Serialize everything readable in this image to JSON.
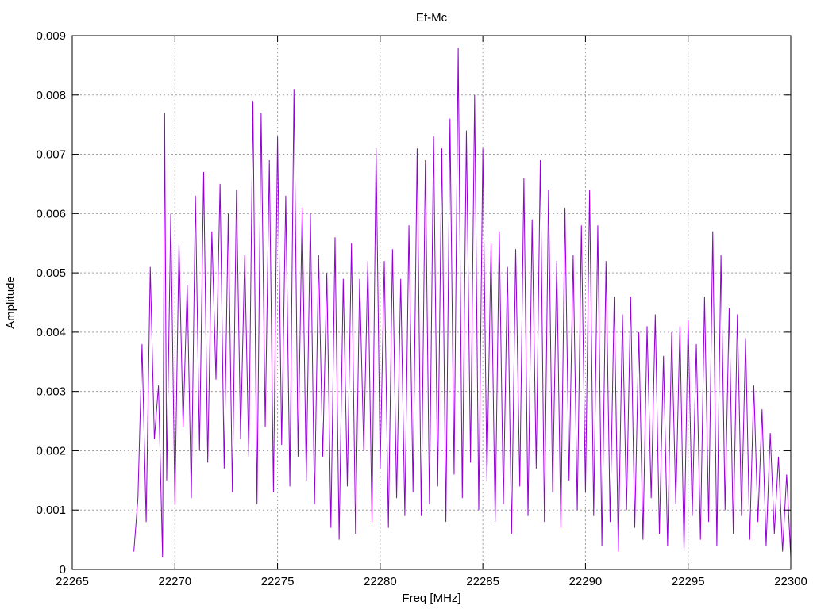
{
  "chart_data": {
    "type": "line",
    "title": "Ef-Mc",
    "xlabel": "Freq [MHz]",
    "ylabel": "Amplitude",
    "xlim": [
      22265,
      22300
    ],
    "ylim": [
      0,
      0.009
    ],
    "xticks": [
      22265,
      22270,
      22275,
      22280,
      22285,
      22290,
      22295,
      22300
    ],
    "yticks": [
      0,
      0.001,
      0.002,
      0.003,
      0.004,
      0.005,
      0.006,
      0.007,
      0.008,
      0.009
    ],
    "xtick_labels": [
      "22265",
      "22270",
      "22275",
      "22280",
      "22285",
      "22290",
      "22295",
      "22300"
    ],
    "ytick_labels": [
      "0",
      "0.001",
      "0.002",
      "0.003",
      "0.004",
      "0.005",
      "0.006",
      "0.007",
      "0.008",
      "0.009"
    ],
    "grid": true,
    "series": [
      {
        "color": "#9400d3",
        "x": [
          22268.0,
          22268.2,
          22268.4,
          22268.6,
          22268.8,
          22269.0,
          22269.2,
          22269.4,
          22269.5,
          22269.6,
          22269.8,
          22270.0,
          22270.2,
          22270.4,
          22270.6,
          22270.8,
          22271.0,
          22271.2,
          22271.4,
          22271.6,
          22271.8,
          22272.0,
          22272.2,
          22272.4,
          22272.6,
          22272.8,
          22273.0,
          22273.2,
          22273.4,
          22273.6,
          22273.8,
          22274.0,
          22274.2,
          22274.4,
          22274.6,
          22274.8,
          22275.0,
          22275.2,
          22275.4,
          22275.6,
          22275.8,
          22276.0,
          22276.2,
          22276.4,
          22276.6,
          22276.8,
          22277.0,
          22277.2,
          22277.4,
          22277.6,
          22277.8,
          22278.0,
          22278.2,
          22278.4,
          22278.6,
          22278.8,
          22279.0,
          22279.2,
          22279.4,
          22279.6,
          22279.8,
          22280.0,
          22280.2,
          22280.4,
          22280.6,
          22280.8,
          22281.0,
          22281.2,
          22281.4,
          22281.6,
          22281.8,
          22282.0,
          22282.2,
          22282.4,
          22282.6,
          22282.8,
          22283.0,
          22283.2,
          22283.4,
          22283.6,
          22283.8,
          22284.0,
          22284.2,
          22284.4,
          22284.6,
          22284.8,
          22285.0,
          22285.2,
          22285.4,
          22285.6,
          22285.8,
          22286.0,
          22286.2,
          22286.4,
          22286.6,
          22286.8,
          22287.0,
          22287.2,
          22287.4,
          22287.6,
          22287.8,
          22288.0,
          22288.2,
          22288.4,
          22288.6,
          22288.8,
          22289.0,
          22289.2,
          22289.4,
          22289.6,
          22289.8,
          22290.0,
          22290.2,
          22290.4,
          22290.6,
          22290.8,
          22291.0,
          22291.2,
          22291.4,
          22291.6,
          22291.8,
          22292.0,
          22292.2,
          22292.4,
          22292.6,
          22292.8,
          22293.0,
          22293.2,
          22293.4,
          22293.6,
          22293.8,
          22294.0,
          22294.2,
          22294.4,
          22294.6,
          22294.8,
          22295.0,
          22295.2,
          22295.4,
          22295.6,
          22295.8,
          22296.0,
          22296.2,
          22296.4,
          22296.6,
          22296.8,
          22297.0,
          22297.2,
          22297.4,
          22297.6,
          22297.8,
          22298.0,
          22298.2,
          22298.4,
          22298.6,
          22298.8,
          22299.0,
          22299.2,
          22299.4,
          22299.6,
          22299.8,
          22300.0
        ],
        "y": [
          0.0003,
          0.0012,
          0.0038,
          0.0008,
          0.0051,
          0.0022,
          0.0031,
          0.0002,
          0.0077,
          0.0015,
          0.006,
          0.0011,
          0.0055,
          0.0024,
          0.0048,
          0.0012,
          0.0063,
          0.002,
          0.0067,
          0.0018,
          0.0057,
          0.0032,
          0.0065,
          0.0017,
          0.006,
          0.0013,
          0.0064,
          0.0022,
          0.0053,
          0.0019,
          0.0079,
          0.0011,
          0.0077,
          0.0024,
          0.0069,
          0.0013,
          0.0073,
          0.0021,
          0.0063,
          0.0014,
          0.0081,
          0.0019,
          0.0061,
          0.0015,
          0.006,
          0.0011,
          0.0053,
          0.0019,
          0.005,
          0.0007,
          0.0056,
          0.0005,
          0.0049,
          0.0014,
          0.0055,
          0.0006,
          0.0049,
          0.002,
          0.0052,
          0.0008,
          0.0071,
          0.0017,
          0.0052,
          0.0007,
          0.0054,
          0.0012,
          0.0049,
          0.0009,
          0.0058,
          0.0013,
          0.0071,
          0.0009,
          0.0069,
          0.0011,
          0.0073,
          0.0014,
          0.0071,
          0.0008,
          0.0076,
          0.0016,
          0.0088,
          0.0012,
          0.0074,
          0.0018,
          0.008,
          0.001,
          0.0071,
          0.0015,
          0.0055,
          0.0008,
          0.0057,
          0.0011,
          0.0051,
          0.0006,
          0.0054,
          0.0014,
          0.0066,
          0.0009,
          0.0059,
          0.0017,
          0.0069,
          0.0008,
          0.0064,
          0.0013,
          0.0052,
          0.0007,
          0.0061,
          0.0015,
          0.0053,
          0.001,
          0.0058,
          0.0013,
          0.0064,
          0.0009,
          0.0058,
          0.0004,
          0.0052,
          0.0008,
          0.0046,
          0.0003,
          0.0043,
          0.001,
          0.0046,
          0.0007,
          0.004,
          0.0005,
          0.0041,
          0.0012,
          0.0043,
          0.0006,
          0.0036,
          0.0004,
          0.004,
          0.0011,
          0.0041,
          0.0003,
          0.0042,
          0.0009,
          0.0038,
          0.0005,
          0.0046,
          0.0008,
          0.0057,
          0.0004,
          0.0053,
          0.001,
          0.0044,
          0.0006,
          0.0043,
          0.0009,
          0.0039,
          0.0005,
          0.0031,
          0.0008,
          0.0027,
          0.0004,
          0.0023,
          0.0006,
          0.0019,
          0.0003,
          0.0016,
          0.0002
        ]
      }
    ]
  }
}
